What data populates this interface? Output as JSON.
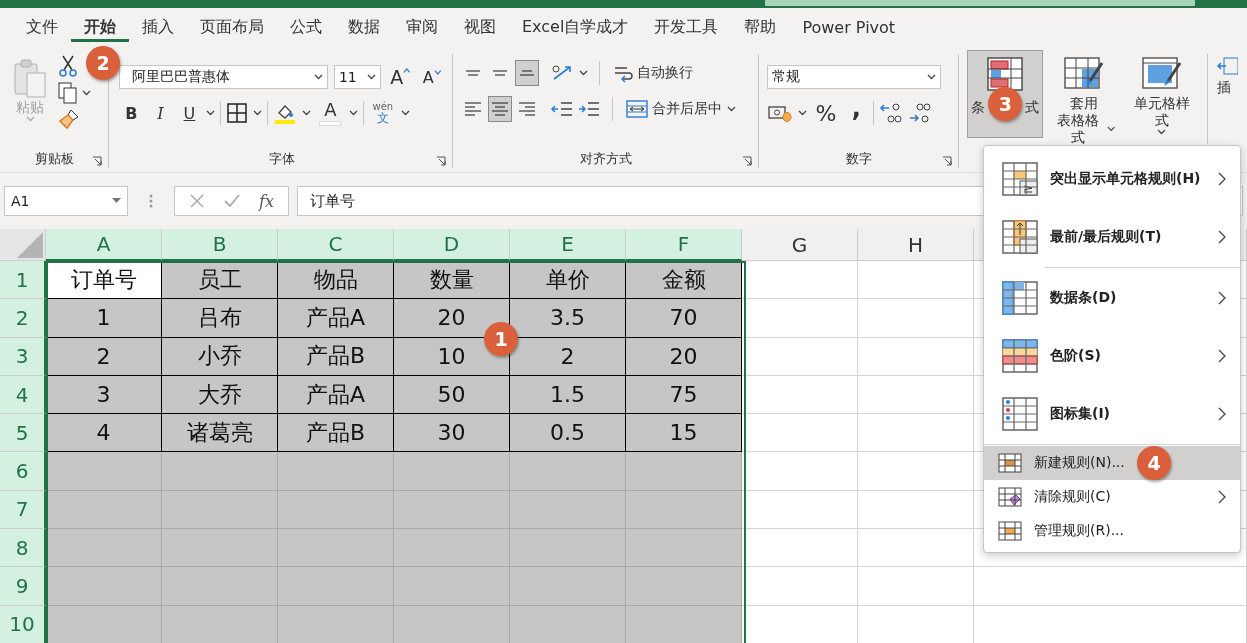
{
  "tabs": [
    {
      "label": "文件",
      "selected": false
    },
    {
      "label": "开始",
      "selected": true
    },
    {
      "label": "插入",
      "selected": false
    },
    {
      "label": "页面布局",
      "selected": false
    },
    {
      "label": "公式",
      "selected": false
    },
    {
      "label": "数据",
      "selected": false
    },
    {
      "label": "审阅",
      "selected": false
    },
    {
      "label": "视图",
      "selected": false
    },
    {
      "label": "Excel自学成才",
      "selected": false
    },
    {
      "label": "开发工具",
      "selected": false
    },
    {
      "label": "帮助",
      "selected": false
    },
    {
      "label": "Power Pivot",
      "selected": false
    }
  ],
  "clipboard": {
    "paste": "粘贴",
    "group": "剪贴板"
  },
  "font": {
    "name": "阿里巴巴普惠体",
    "size": "11",
    "bold": "B",
    "italic": "I",
    "underline": "U",
    "font_color": "A",
    "grow": "A",
    "shrink": "A",
    "phonetic": [
      "wén",
      "文"
    ],
    "group": "字体",
    "badge": "2"
  },
  "alignment": {
    "vertical_buttons": [
      {
        "selected": false
      },
      {
        "selected": false
      },
      {
        "selected": true
      }
    ],
    "horizontal_buttons": [
      {
        "selected": false
      },
      {
        "selected": true
      },
      {
        "selected": false
      }
    ],
    "wrap": "自动换行",
    "merge": "合并后居中",
    "group": "对齐方式"
  },
  "number": {
    "format": "常规",
    "percent": "%",
    "comma": ",",
    "group": "数字"
  },
  "styles": {
    "conditional": {
      "label_parts": [
        "条",
        "式"
      ],
      "selected": true,
      "badge": "3"
    },
    "table_format": [
      "套用",
      "表格格式"
    ],
    "cell_styles": "单元格样式",
    "insert": "插"
  },
  "formula_bar": {
    "name_box": "A1",
    "fx": "fx",
    "content": "订单号"
  },
  "sheet": {
    "columns": [
      {
        "label": "A",
        "selected": true
      },
      {
        "label": "B",
        "selected": true
      },
      {
        "label": "C",
        "selected": true
      },
      {
        "label": "D",
        "selected": true
      },
      {
        "label": "E",
        "selected": true
      },
      {
        "label": "F",
        "selected": true
      },
      {
        "label": "G",
        "selected": false
      },
      {
        "label": "H",
        "selected": false
      }
    ],
    "rows": [
      {
        "label": "1",
        "selected": true,
        "bordered": true,
        "cells": [
          {
            "text": "订单号",
            "active": true
          },
          {
            "text": "员工",
            "active": false
          },
          {
            "text": "物品",
            "active": false
          },
          {
            "text": "数量",
            "active": false
          },
          {
            "text": "单价",
            "active": false
          },
          {
            "text": "金额",
            "active": false
          }
        ]
      },
      {
        "label": "2",
        "selected": true,
        "bordered": true,
        "cells": [
          {
            "text": "1",
            "active": false
          },
          {
            "text": "吕布",
            "active": false
          },
          {
            "text": "产品A",
            "active": false
          },
          {
            "text": "20",
            "active": false
          },
          {
            "text": "3.5",
            "active": false
          },
          {
            "text": "70",
            "active": false
          }
        ]
      },
      {
        "label": "3",
        "selected": true,
        "bordered": true,
        "cells": [
          {
            "text": "2",
            "active": false
          },
          {
            "text": "小乔",
            "active": false
          },
          {
            "text": "产品B",
            "active": false
          },
          {
            "text": "10",
            "active": false
          },
          {
            "text": "2",
            "active": false
          },
          {
            "text": "20",
            "active": false
          }
        ]
      },
      {
        "label": "4",
        "selected": true,
        "bordered": true,
        "cells": [
          {
            "text": "3",
            "active": false
          },
          {
            "text": "大乔",
            "active": false
          },
          {
            "text": "产品A",
            "active": false
          },
          {
            "text": "50",
            "active": false
          },
          {
            "text": "1.5",
            "active": false
          },
          {
            "text": "75",
            "active": false
          }
        ]
      },
      {
        "label": "5",
        "selected": true,
        "bordered": true,
        "cells": [
          {
            "text": "4",
            "active": false
          },
          {
            "text": "诸葛亮",
            "active": false
          },
          {
            "text": "产品B",
            "active": false
          },
          {
            "text": "30",
            "active": false
          },
          {
            "text": "0.5",
            "active": false
          },
          {
            "text": "15",
            "active": false
          }
        ]
      },
      {
        "label": "6",
        "selected": true,
        "bordered": false
      },
      {
        "label": "7",
        "selected": true,
        "bordered": false
      },
      {
        "label": "8",
        "selected": true,
        "bordered": false
      },
      {
        "label": "9",
        "selected": true,
        "bordered": false
      },
      {
        "label": "10",
        "selected": true,
        "bordered": false
      }
    ],
    "badge": "1"
  },
  "menu": {
    "items": [
      {
        "label": "突出显示单元格规则(H)",
        "kind": "large",
        "submenu": true,
        "selected": false
      },
      {
        "label": "最前/最后规则(T)",
        "kind": "large",
        "submenu": true,
        "selected": false
      },
      {
        "label": "数据条(D)",
        "kind": "large",
        "submenu": true,
        "selected": false
      },
      {
        "label": "色阶(S)",
        "kind": "large",
        "submenu": true,
        "selected": false
      },
      {
        "label": "图标集(I)",
        "kind": "large",
        "submenu": true,
        "selected": false
      },
      {
        "label": "新建规则(N)...",
        "kind": "small",
        "submenu": false,
        "selected": true,
        "badge": "4"
      },
      {
        "label": "清除规则(C)",
        "kind": "small",
        "submenu": true,
        "selected": false
      },
      {
        "label": "管理规则(R)...",
        "kind": "small",
        "submenu": false,
        "selected": false
      }
    ]
  }
}
